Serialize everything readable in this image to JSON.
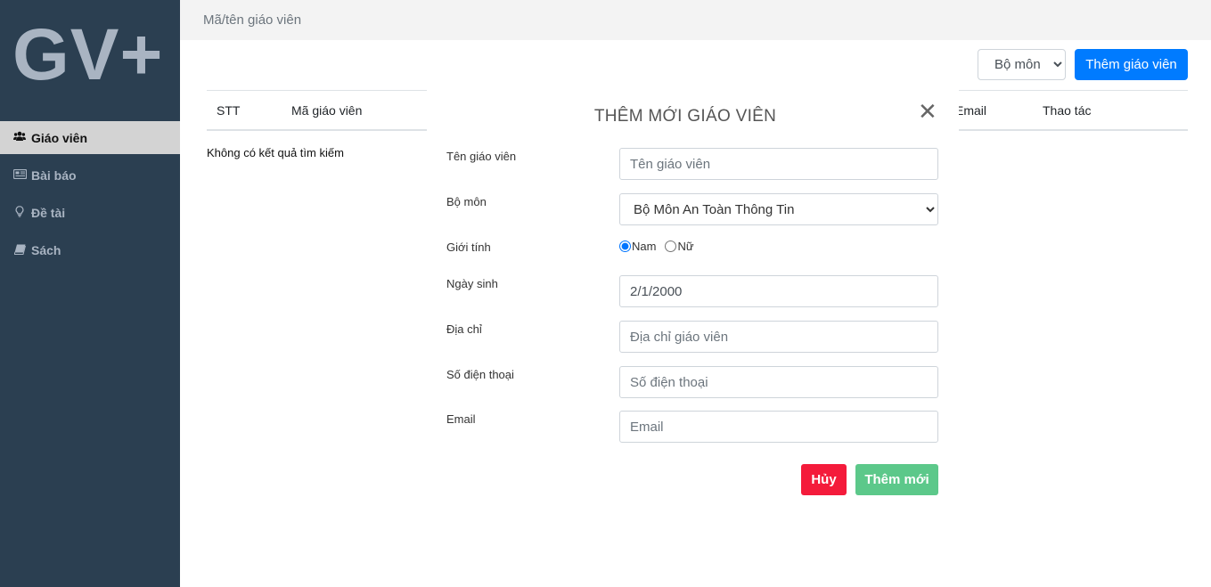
{
  "sidebar": {
    "logo": "GV+",
    "items": [
      {
        "label": "Giáo viên",
        "icon": "users-icon"
      },
      {
        "label": "Bài báo",
        "icon": "newspaper-icon"
      },
      {
        "label": "Đề tài",
        "icon": "lightbulb-icon"
      },
      {
        "label": "Sách",
        "icon": "book-icon"
      }
    ]
  },
  "topbar": {
    "search_placeholder": "Mã/tên giáo viên"
  },
  "toolbar": {
    "filter_value": "Bộ môn",
    "add_label": "Thêm giáo viên"
  },
  "table": {
    "columns": [
      "STT",
      "Mã giáo viên",
      "Email",
      "Thao tác"
    ],
    "empty_message": "Không có kết quả tìm kiếm"
  },
  "modal": {
    "title": "THÊM MỚI GIÁO VIÊN",
    "fields": {
      "name": {
        "label": "Tên giáo viên",
        "placeholder": "Tên giáo viên",
        "value": ""
      },
      "department": {
        "label": "Bộ môn",
        "value": "Bộ Môn An Toàn Thông Tin"
      },
      "gender": {
        "label": "Giới tính",
        "options": [
          "Nam",
          "Nữ"
        ],
        "selected": "Nam"
      },
      "birthday": {
        "label": "Ngày sinh",
        "value": "2/1/2000"
      },
      "address": {
        "label": "Địa chỉ",
        "placeholder": "Địa chỉ giáo viên"
      },
      "phone": {
        "label": "Số điện thoại",
        "placeholder": "Số điện thoại"
      },
      "email": {
        "label": "Email",
        "placeholder": "Email"
      }
    },
    "cancel_label": "Hủy",
    "submit_label": "Thêm mới"
  },
  "colors": {
    "sidebar_bg": "#2b3f51",
    "primary": "#007bff",
    "danger": "#f41b3b",
    "success": "#5cc88a"
  }
}
